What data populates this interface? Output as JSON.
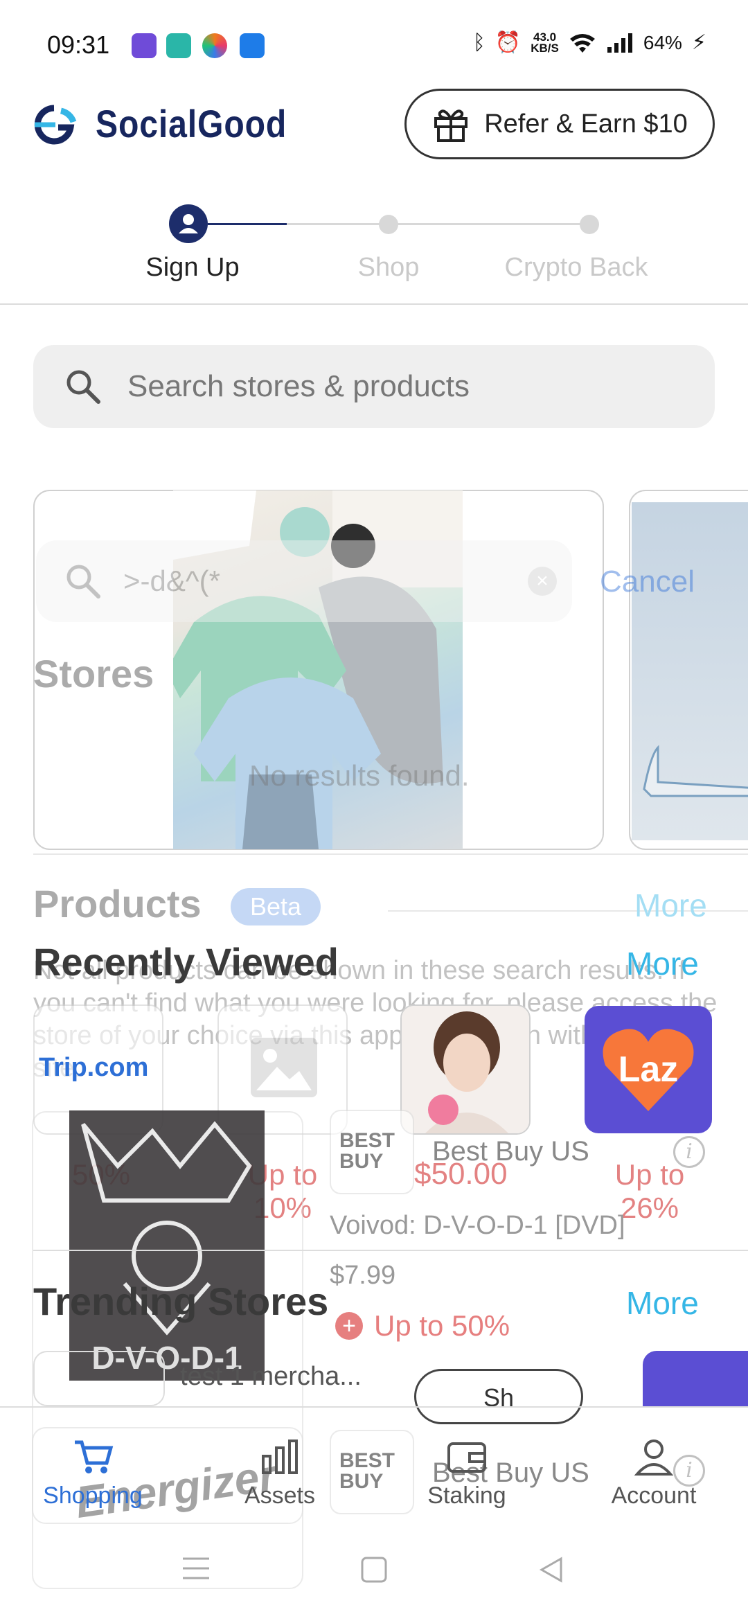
{
  "status_bar": {
    "time": "09:31",
    "net_speed_value": "43.0",
    "net_speed_unit": "KB/S",
    "battery": "64%",
    "icons": [
      "lazada-1212-icon",
      "chat-bubble-icon",
      "browser-icon",
      "usb-icon",
      "bluetooth-icon",
      "alarm-icon",
      "wifi-icon",
      "signal-icon",
      "charging-icon"
    ],
    "app_icon_colors": [
      "#6f4bd8",
      "#2ab6a8",
      "#f07a1c",
      "#1e7ce8"
    ]
  },
  "header": {
    "brand": "SocialGood",
    "refer_label": "Refer & Earn $10",
    "brand_color": "#17265e"
  },
  "stepper": {
    "steps": [
      {
        "label": "Sign Up",
        "active": true
      },
      {
        "label": "Shop",
        "active": false
      },
      {
        "label": "Crypto Back",
        "active": false
      }
    ]
  },
  "search": {
    "placeholder": "Search stores & products"
  },
  "overlay": {
    "query": ">-d&^(*",
    "cancel": "Cancel",
    "stores_heading": "Stores",
    "no_results": "No results found.",
    "products_heading": "Products",
    "beta": "Beta",
    "more": "More",
    "note": "Not all products can be shown in these search results. If you can't find what you were looking for, please access the store of your choice via this app and search within their site."
  },
  "recently_viewed": {
    "title": "Recently Viewed",
    "more": "More",
    "items": [
      {
        "name": "Trip.com",
        "cashback": "50%"
      },
      {
        "name": "",
        "cashback": "Up to 10%"
      },
      {
        "name": "",
        "cashback": "$50.00"
      },
      {
        "name": "Laz",
        "cashback": "Up to 26%"
      }
    ]
  },
  "product": {
    "store_logo": "BEST BUY",
    "store": "Best Buy US",
    "title": "Voivod: D-V-O-D-1 [DVD]",
    "price": "$7.99",
    "cashback": "Up to 50%",
    "album_text": "D-V-O-D-1"
  },
  "trending": {
    "title": "Trending Stores",
    "more": "More",
    "merchant": "test 1 mercha...",
    "shop_button": "Sh"
  },
  "second_product": {
    "store_logo": "BEST BUY",
    "store": "Best Buy US",
    "logo_text": "Energizer"
  },
  "bottom_nav": {
    "items": [
      {
        "label": "Shopping",
        "icon": "cart-icon",
        "active": true
      },
      {
        "label": "Assets",
        "icon": "bar-chart-icon",
        "active": false
      },
      {
        "label": "Staking",
        "icon": "wallet-icon",
        "active": false
      },
      {
        "label": "Account",
        "icon": "user-icon",
        "active": false
      }
    ],
    "active_color": "#2d6fd6"
  },
  "system_nav": [
    "menu-icon",
    "home-icon",
    "back-icon"
  ]
}
